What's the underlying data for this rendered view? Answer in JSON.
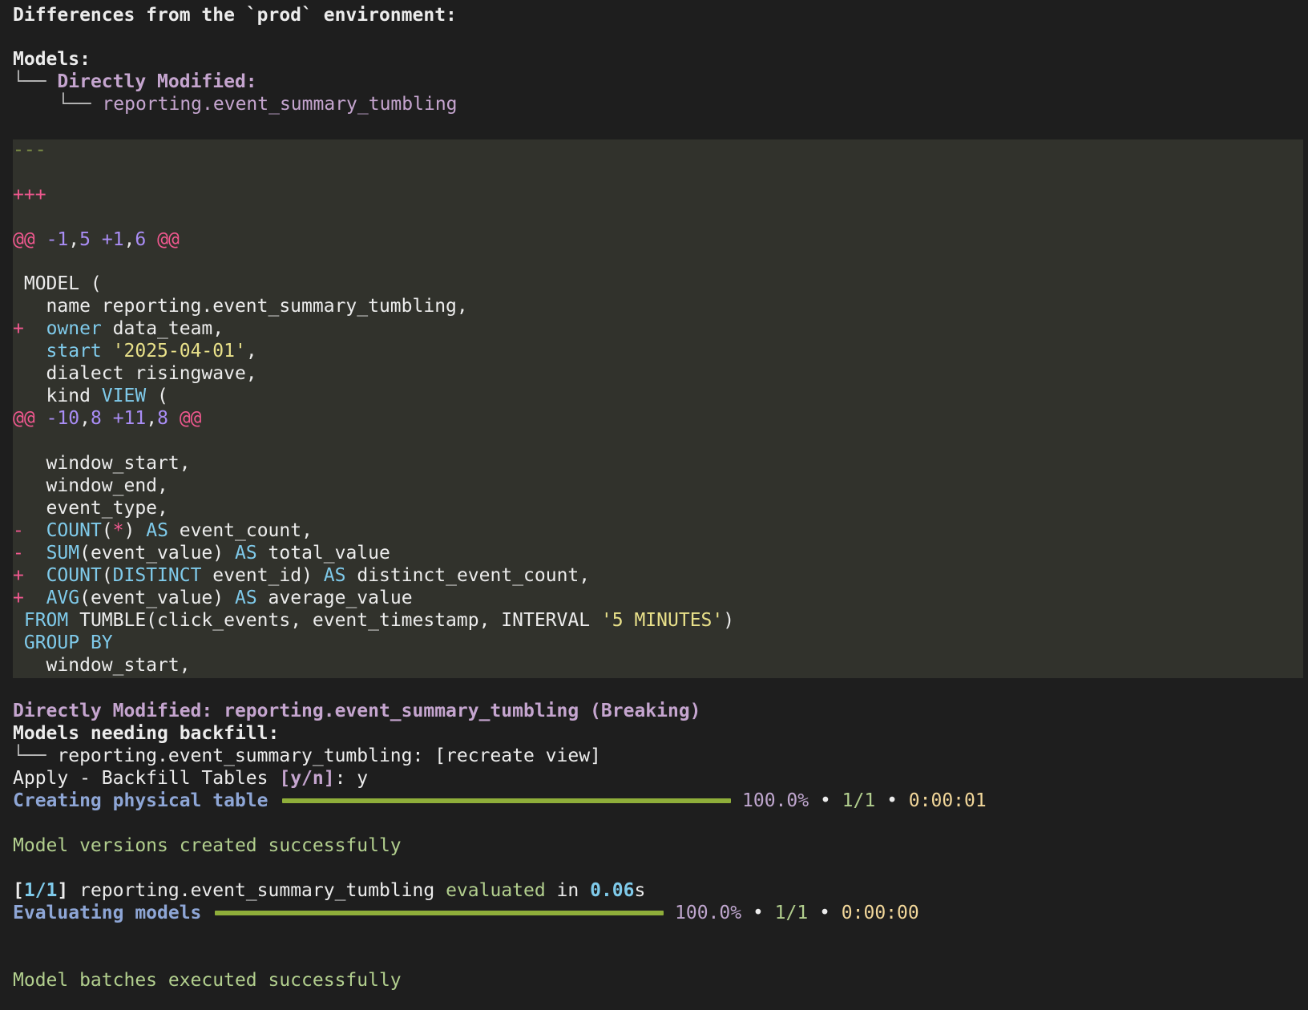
{
  "header": {
    "title": "Differences from the `prod` environment:",
    "models_label": "Models:",
    "tree_branch": "└──",
    "directly_modified_label": "Directly Modified:",
    "model_name": "reporting.event_summary_tumbling"
  },
  "diff": {
    "minus_header": "---",
    "plus_header": "+++",
    "hunk1": {
      "at_open": "@@",
      "minus": "-1",
      "minus_count": "5",
      "plus": "+1",
      "plus_count": "6",
      "at_close": "@@"
    },
    "hunk2": {
      "at_open": "@@",
      "minus": "-10",
      "minus_count": "8",
      "plus": "+11",
      "plus_count": "8",
      "at_close": "@@"
    },
    "lines": {
      "model_open": " MODEL (",
      "name_line": "   name reporting.event_summary_tumbling,",
      "owner_marker": "+",
      "owner_kw": "owner",
      "owner_val": " data_team,",
      "start_kw": "start",
      "start_val": "'2025-04-01'",
      "start_comma": ",",
      "dialect_line": "   dialect risingwave,",
      "kind_text": "   kind ",
      "kind_kw": "VIEW",
      "kind_paren": " (",
      "window_start": "   window_start,",
      "window_end": "   window_end,",
      "event_type": "   event_type,",
      "del_marker": "-",
      "count_fn": "COUNT",
      "count_open": "(",
      "star": "*",
      "count_close": ") ",
      "as_kw": "AS",
      "event_count": " event_count,",
      "sum_fn": "SUM",
      "sum_args": "(event_value) ",
      "total_value": " total_value",
      "add_marker": "+",
      "distinct_kw": "DISTINCT",
      "distinct_args": " event_id) ",
      "distinct_event_count": " distinct_event_count,",
      "avg_fn": "AVG",
      "avg_args": "(event_value) ",
      "average_value": " average_value",
      "from_kw": "FROM",
      "from_rest": " TUMBLE(click_events, event_timestamp, INTERVAL ",
      "interval_val": "'5 MINUTES'",
      "from_close": ")",
      "group_by_kw": "GROUP BY",
      "window_start_last": "   window_start,"
    }
  },
  "summary": {
    "directly_modified": "Directly Modified: reporting.event_summary_tumbling (Breaking)",
    "models_needing_backfill": "Models needing backfill:",
    "backfill_item": " reporting.event_summary_tumbling: [recreate view]",
    "apply_prompt_text": "Apply - Backfill Tables ",
    "apply_prompt_options": "[y/n]",
    "apply_prompt_answer": ": y"
  },
  "progress": [
    {
      "label": "Creating physical table",
      "percent_text": "100.0%",
      "bullet": "•",
      "count": "1/1",
      "time": "0:00:01",
      "fraction": 1.0
    },
    {
      "label": "Evaluating models",
      "percent_text": "100.0%",
      "bullet": "•",
      "count": "1/1",
      "time": "0:00:00",
      "fraction": 1.0
    }
  ],
  "messages": {
    "versions_created": "Model versions created successfully",
    "eval_open": "[",
    "eval_count": "1/1",
    "eval_close": "]",
    "eval_model": " reporting.event_summary_tumbling ",
    "eval_word": "evaluated",
    "eval_in": " in ",
    "eval_time_num": "0.06",
    "eval_time_unit": "s",
    "batches_executed": "Model batches executed successfully"
  },
  "colors": {
    "background": "#1e1e1e",
    "diff_background": "#31322c",
    "progress_bar": "#8fae3a",
    "success_text": "#b2cf8e"
  }
}
